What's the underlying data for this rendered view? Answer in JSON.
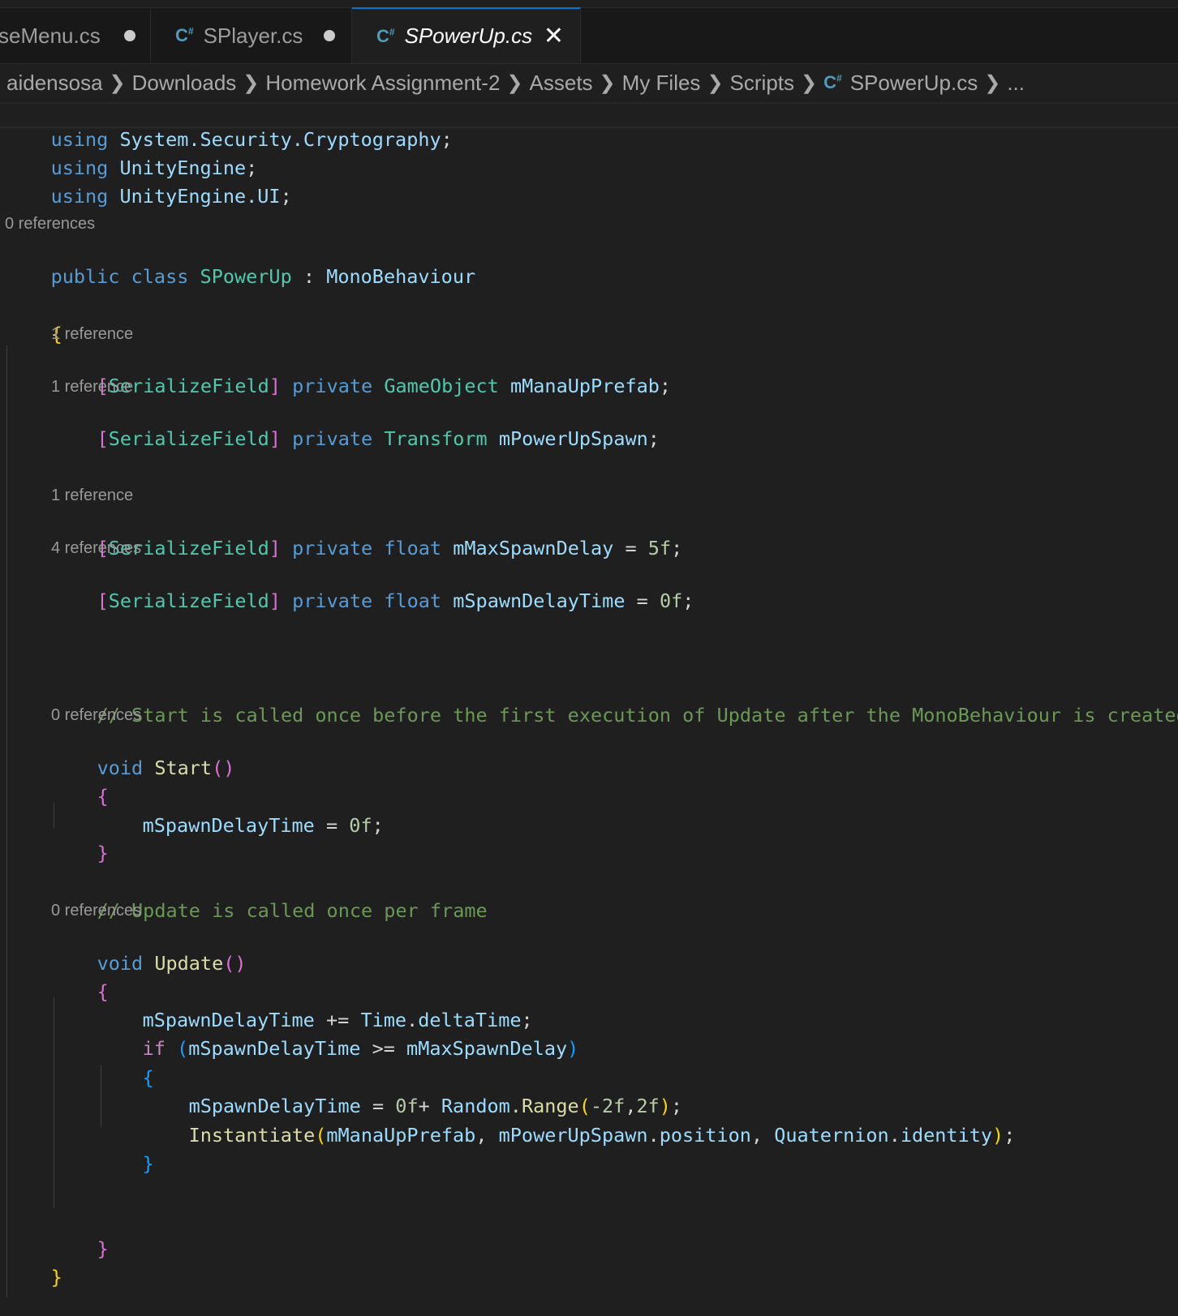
{
  "tabs": [
    {
      "label": "seMenu.cs",
      "state": "modified"
    },
    {
      "label": "SPlayer.cs",
      "state": "modified"
    },
    {
      "label": "SPowerUp.cs",
      "state": "active"
    }
  ],
  "breadcrumb": {
    "items": [
      "aidensosa",
      "Downloads",
      "Homework Assignment-2",
      "Assets",
      "My Files",
      "Scripts"
    ],
    "file": "SPowerUp.cs",
    "more": "..."
  },
  "editor": {
    "language_icon": "C#",
    "lines": {
      "u1": {
        "kw": "using",
        "ns": "System.Security.Cryptography",
        "end": ";"
      },
      "u2": {
        "kw": "using",
        "ns": "UnityEngine",
        "end": ";"
      },
      "u3": {
        "kw": "using",
        "ns": "UnityEngine.UI",
        "end": ";"
      },
      "lens_class": "0 references",
      "class_kw1": "public",
      "class_kw2": "class",
      "class_name": "SPowerUp",
      "class_colon": ":",
      "class_base": "MonoBehaviour",
      "open_brace": "{",
      "lens_f1": "1 reference",
      "f1": {
        "attr": "SerializeField",
        "mod": "private",
        "type": "GameObject",
        "name": "mManaUpPrefab",
        "end": ";"
      },
      "lens_f2": "1 reference",
      "f2": {
        "attr": "SerializeField",
        "mod": "private",
        "type": "Transform",
        "name": "mPowerUpSpawn",
        "end": ";"
      },
      "lens_f3": "1 reference",
      "f3": {
        "attr": "SerializeField",
        "mod": "private",
        "type": "float",
        "name": "mMaxSpawnDelay",
        "op": "=",
        "val": "5f",
        "end": ";"
      },
      "lens_f4": "4 references",
      "f4": {
        "attr": "SerializeField",
        "mod": "private",
        "type": "float",
        "name": "mSpawnDelayTime",
        "op": "=",
        "val": "0f",
        "end": ";"
      },
      "comment_start": "// Start is called once before the first execution of Update after the MonoBehaviour is created",
      "lens_start": "0 references",
      "start_kw": "void",
      "start_name": "Start",
      "start_body": {
        "name": "mSpawnDelayTime",
        "op": "=",
        "val": "0f",
        "end": ";"
      },
      "comment_update": "// Update is called once per frame",
      "lens_update": "0 references",
      "update_kw": "void",
      "update_name": "Update",
      "upd1": {
        "name": "mSpawnDelayTime",
        "op": "+=",
        "cls": "Time",
        "prop": "deltaTime",
        "end": ";"
      },
      "upd2": {
        "kw": "if",
        "a": "mSpawnDelayTime",
        "op": ">=",
        "b": "mMaxSpawnDelay"
      },
      "upd3": {
        "name": "mSpawnDelayTime",
        "op": "=",
        "val": "0f",
        "plus": "+",
        "cls": "Random",
        "fn": "Range",
        "arg1": "-2f",
        "arg2": "2f",
        "end": ";"
      },
      "upd4": {
        "fn": "Instantiate",
        "a1": "mManaUpPrefab",
        "a2obj": "mPowerUpSpawn",
        "a2prop": "position",
        "a3cls": "Quaternion",
        "a3prop": "identity",
        "end": ";"
      },
      "close_brace": "}"
    }
  }
}
